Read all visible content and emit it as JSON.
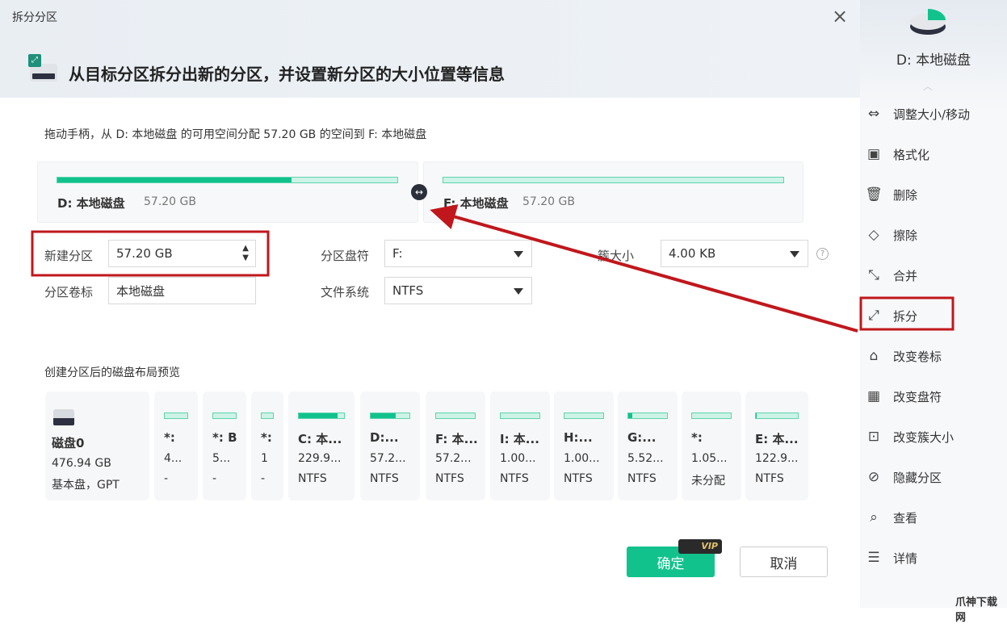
{
  "dialog": {
    "title": "拆分分区",
    "heading": "从目标分区拆分出新的分区，并设置新分区的大小位置等信息",
    "instruction": "拖动手柄，从 D: 本地磁盘 的可用空间分配 57.20  GB 的空间到 F: 本地磁盘"
  },
  "source": {
    "name": "D: 本地磁盘",
    "size": "57.20  GB",
    "used_fraction": 0.69
  },
  "target": {
    "name": "F: 本地磁盘",
    "size": "57.20  GB",
    "used_fraction": 0
  },
  "form": {
    "new_partition_label": "新建分区",
    "new_partition_value": "57.20  GB",
    "drive_letter_label": "分区盘符",
    "drive_letter_value": "F:",
    "cluster_label": "簇大小",
    "cluster_value": "4.00 KB",
    "volume_label_label": "分区卷标",
    "volume_label_value": "本地磁盘",
    "fs_label": "文件系统",
    "fs_value": "NTFS"
  },
  "preview": {
    "title": "创建分区后的磁盘布局预览",
    "disk": {
      "name": "磁盘0",
      "size": "476.94  GB",
      "type": "基本盘，GPT"
    },
    "partitions": [
      {
        "name": "*:",
        "size": "4...",
        "fs": "-",
        "used": 0
      },
      {
        "name": "*: B",
        "size": "5...",
        "fs": "-",
        "used": 0
      },
      {
        "name": "*:",
        "size": "1",
        "fs": "-",
        "used": 0
      },
      {
        "name": "C: 本...",
        "size": "229.9...",
        "fs": "NTFS",
        "used": 0.85
      },
      {
        "name": "D:...",
        "size": "57.2...",
        "fs": "NTFS",
        "used": 0.65
      },
      {
        "name": "F: 本...",
        "size": "57.2...",
        "fs": "NTFS",
        "used": 0
      },
      {
        "name": "I: 本...",
        "size": "1.00...",
        "fs": "NTFS",
        "used": 0
      },
      {
        "name": "H:...",
        "size": "1.00...",
        "fs": "NTFS",
        "used": 0
      },
      {
        "name": "G:...",
        "size": "5.52...",
        "fs": "NTFS",
        "used": 0.1
      },
      {
        "name": "*:",
        "size": "1.05...",
        "fs": "未分配",
        "used": 0
      },
      {
        "name": "E: 本...",
        "size": "122.9...",
        "fs": "NTFS",
        "used": 0.02
      }
    ]
  },
  "buttons": {
    "ok": "确定",
    "cancel": "取消",
    "vip": "VIP"
  },
  "sidebar": {
    "disk_name": "D: 本地磁盘",
    "items": [
      {
        "label": "调整大小/移动",
        "icon": "⇔"
      },
      {
        "label": "格式化",
        "icon": "▣"
      },
      {
        "label": "删除",
        "icon": "🗑"
      },
      {
        "label": "擦除",
        "icon": "◇"
      },
      {
        "label": "合并",
        "icon": "⤡"
      },
      {
        "label": "拆分",
        "icon": "⤢"
      },
      {
        "label": "改变卷标",
        "icon": "⌂"
      },
      {
        "label": "改变盘符",
        "icon": "▦"
      },
      {
        "label": "改变簇大小",
        "icon": "⊡"
      },
      {
        "label": "隐藏分区",
        "icon": "⊘"
      },
      {
        "label": "查看",
        "icon": "⌕"
      },
      {
        "label": "详情",
        "icon": "☰"
      }
    ]
  },
  "watermark": "爪神下载网",
  "colors": {
    "accent": "#12c28d",
    "annotation": "#c0171c"
  }
}
